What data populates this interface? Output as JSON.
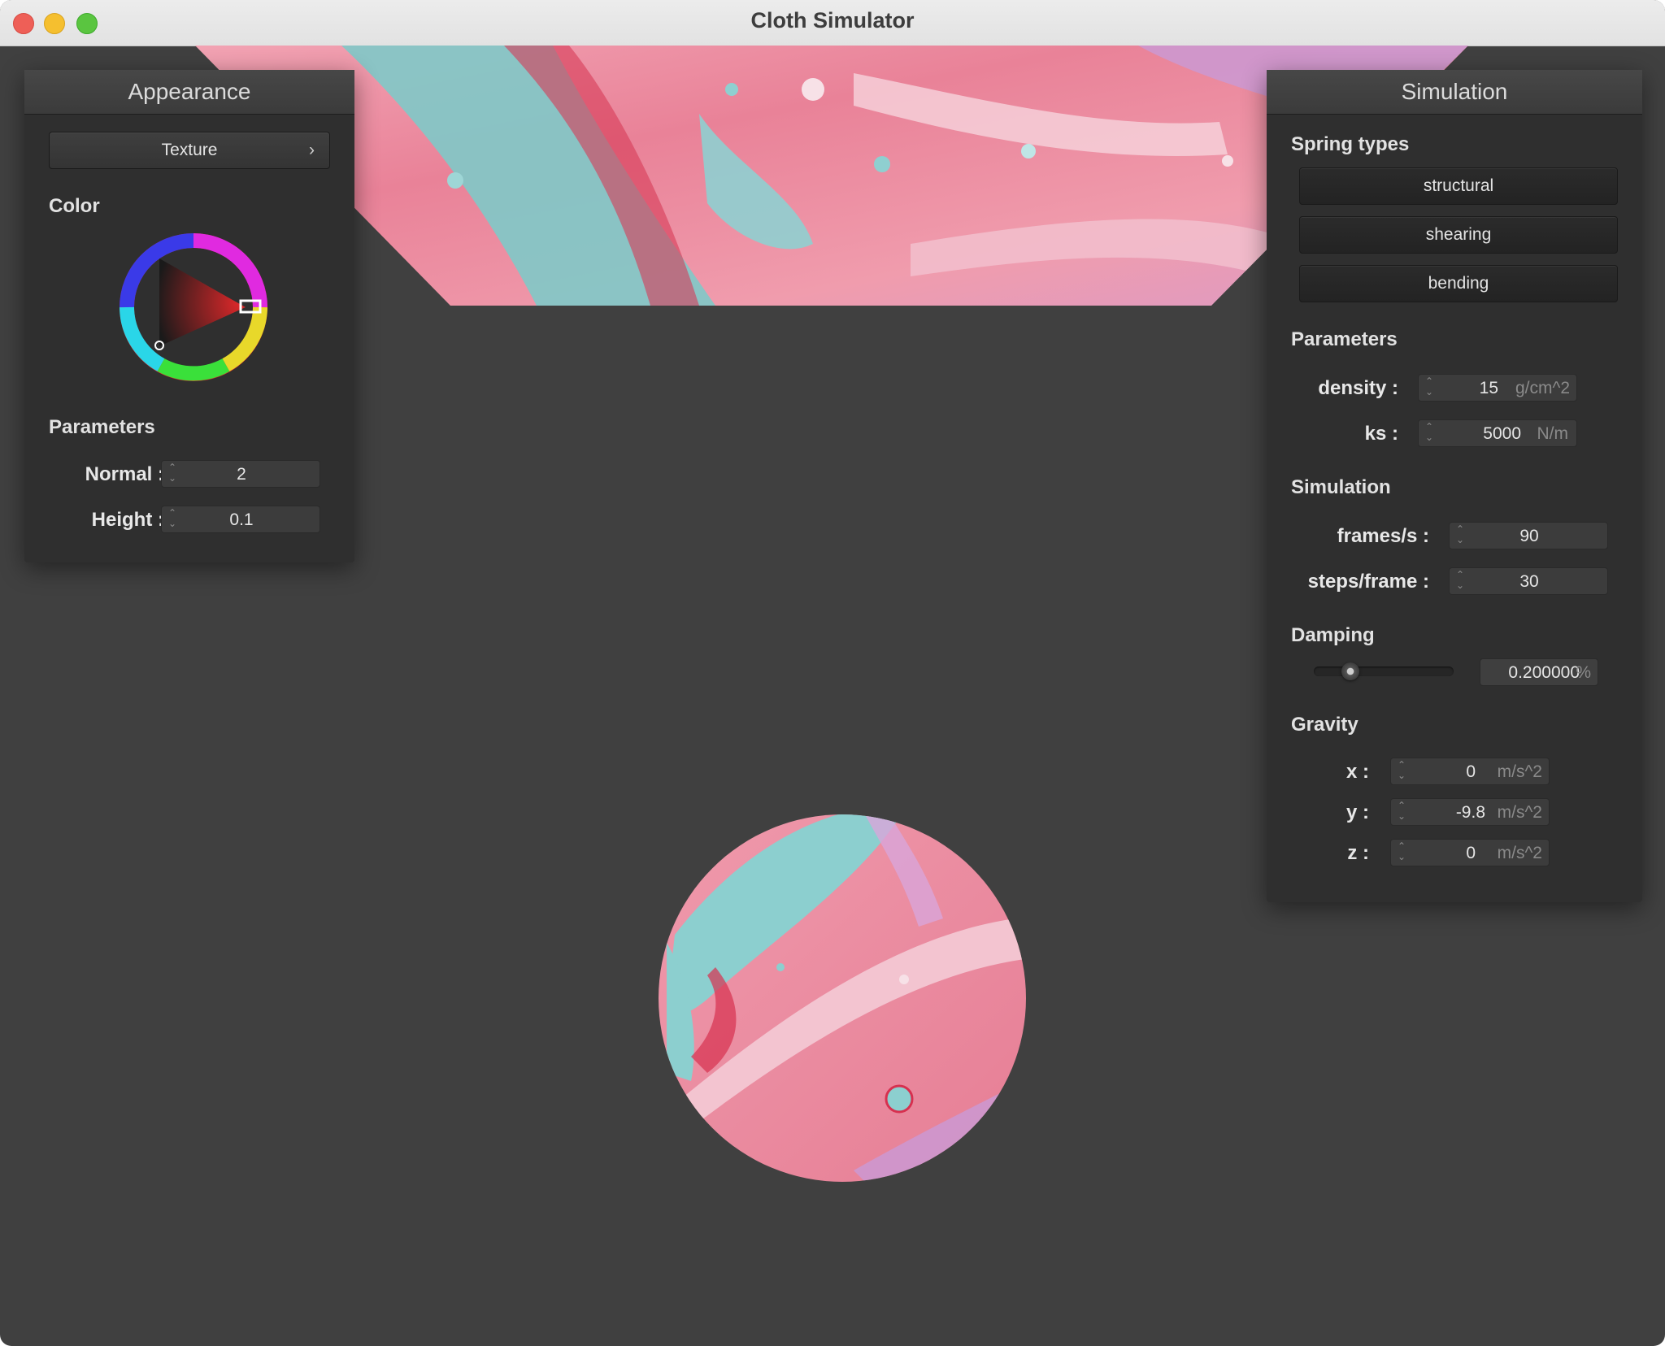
{
  "window": {
    "title": "Cloth Simulator"
  },
  "appearance": {
    "title": "Appearance",
    "texture_button": "Texture",
    "texture_chevron": "›",
    "color_label": "Color",
    "parameters_label": "Parameters",
    "normal": {
      "label": "Normal :",
      "value": "2"
    },
    "height": {
      "label": "Height :",
      "value": "0.1"
    }
  },
  "simulation": {
    "title": "Simulation",
    "spring_types_label": "Spring types",
    "spring_types": [
      "structural",
      "shearing",
      "bending"
    ],
    "parameters_label": "Parameters",
    "density": {
      "label": "density :",
      "value": "15",
      "unit": "g/cm^2"
    },
    "ks": {
      "label": "ks :",
      "value": "5000",
      "unit": "N/m"
    },
    "simulation_label": "Simulation",
    "frames_per_s": {
      "label": "frames/s :",
      "value": "90"
    },
    "steps_per_frame": {
      "label": "steps/frame :",
      "value": "30"
    },
    "damping_label": "Damping",
    "damping": {
      "value": "0.200000",
      "unit": "%",
      "slider_fraction": 0.2
    },
    "gravity_label": "Gravity",
    "gravity": {
      "x": {
        "label": "x :",
        "value": "0",
        "unit": "m/s^2"
      },
      "y": {
        "label": "y :",
        "value": "-9.8",
        "unit": "m/s^2"
      },
      "z": {
        "label": "z :",
        "value": "0",
        "unit": "m/s^2"
      }
    }
  },
  "colors": {
    "viewport_background": "#404040",
    "cloth_pink": "#ec8ea0",
    "cloth_teal": "#7fc9c8",
    "selected_color": "#e0282a"
  }
}
